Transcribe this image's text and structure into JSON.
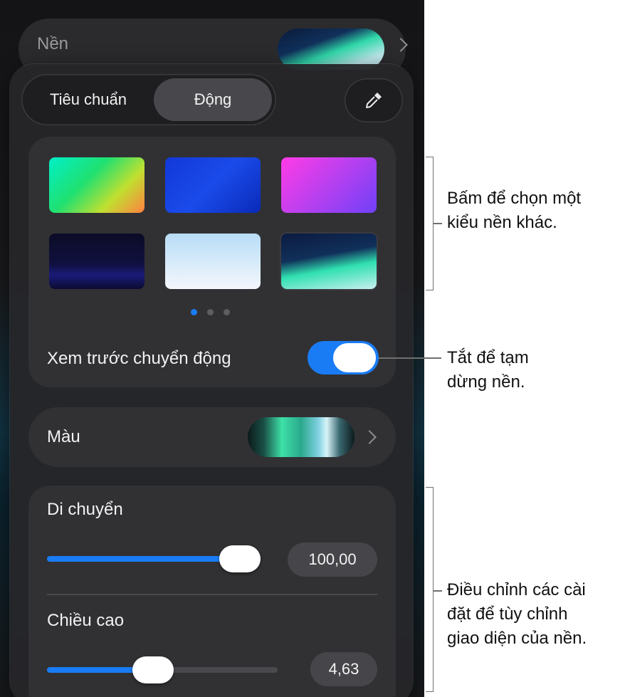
{
  "background_row": {
    "label": "Nền"
  },
  "segmented": {
    "option_standard": "Tiêu chuẩn",
    "option_dynamic": "Động",
    "selected": "Động"
  },
  "eyedropper": {
    "icon": "eyedropper-icon"
  },
  "presets": {
    "pages": 3,
    "current_page": 1,
    "thumbnails": [
      "rainbow-gradient",
      "blue-gradient",
      "magenta-purple-gradient",
      "dark-mountains",
      "light-sky",
      "teal-waves"
    ]
  },
  "motion_preview": {
    "label": "Xem trước chuyển động",
    "on": true
  },
  "color": {
    "label": "Màu"
  },
  "move": {
    "label": "Di chuyển",
    "value": "100,00",
    "fraction": 1.0
  },
  "height": {
    "label": "Chiều cao",
    "value": "4,63",
    "fraction": 0.45
  },
  "callouts": {
    "presets_line1": "Bấm để chọn một",
    "presets_line2": "kiểu nền khác.",
    "toggle_line1": "Tắt để tạm",
    "toggle_line2": "dừng nền.",
    "sliders_line1": "Điều chỉnh các cài",
    "sliders_line2": "đặt để tùy chỉnh",
    "sliders_line3": "giao diện của nền."
  },
  "colors": {
    "accent": "#1a7cf5",
    "panel": "#262629",
    "card": "#313134"
  }
}
